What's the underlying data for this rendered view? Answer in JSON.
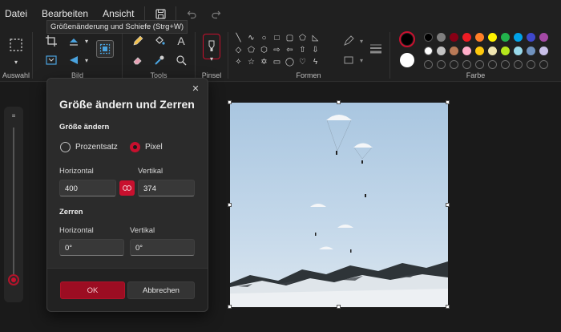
{
  "menubar": {
    "items": [
      "Datei",
      "Bearbeiten",
      "Ansicht"
    ],
    "tooltip": "Größenänderung und Schiefe (Strg+W)"
  },
  "ribbon": {
    "groups": {
      "selection": "Auswahl",
      "image": "Bild",
      "tools": "Tools",
      "brush": "Pinsel",
      "shapes": "Formen",
      "color": "Farbe"
    },
    "text_tool_glyph": "A",
    "palette": [
      "#000000",
      "#7f7f7f",
      "#880015",
      "#ed1c24",
      "#ff7f27",
      "#fff200",
      "#22b14c",
      "#00a2e8",
      "#3f48cc",
      "#a349a4",
      "#ffffff",
      "#c3c3c3",
      "#b97a57",
      "#ffaec9",
      "#ffc90e",
      "#efe4b0",
      "#b5e61d",
      "#99d9ea",
      "#7092be",
      "#c8bfe7"
    ],
    "primary_color": "#000000",
    "secondary_color": "#ffffff",
    "accent": "#c8102e"
  },
  "dialog": {
    "title": "Größe ändern und Zerren",
    "resize_section": "Größe ändern",
    "option_percent": "Prozentsatz",
    "option_pixel": "Pixel",
    "selected_option": "Pixel",
    "horizontal_label": "Horizontal",
    "vertical_label": "Vertikal",
    "horizontal_value": "400",
    "vertical_value": "374",
    "skew_section": "Zerren",
    "skew_horizontal_label": "Horizontal",
    "skew_vertical_label": "Vertikal",
    "skew_horizontal_value": "0°",
    "skew_vertical_value": "0°",
    "ok_label": "OK",
    "cancel_label": "Abbrechen"
  },
  "zoom": {
    "level": 0.03
  }
}
